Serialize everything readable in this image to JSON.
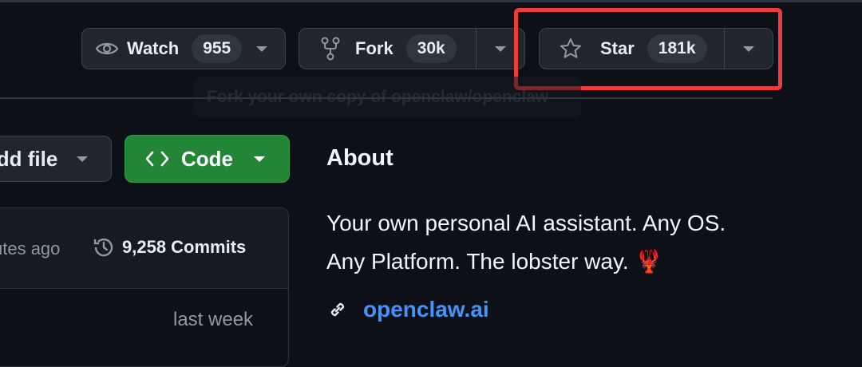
{
  "repo_actions": {
    "watch": {
      "label": "Watch",
      "count": "955"
    },
    "fork": {
      "label": "Fork",
      "count": "30k"
    },
    "star": {
      "label": "Star",
      "count": "181k"
    }
  },
  "tooltip": {
    "text": "Fork your own copy of openclaw/openclaw"
  },
  "code_area": {
    "add_file_label": "Add file",
    "code_label": "Code",
    "last_commit_time": "utes ago",
    "commits_label": "9,258 Commits",
    "file_row_time": "last week"
  },
  "about": {
    "title": "About",
    "description_line1": "Your own personal AI assistant. Any OS.",
    "description_line2": "Any Platform. The lobster way. 🦞",
    "website": "openclaw.ai"
  },
  "colors": {
    "background": "#0d1117",
    "button_bg": "#21262d",
    "code_button": "#238636",
    "link": "#4493f8",
    "highlight_box": "#ee3b3b"
  }
}
